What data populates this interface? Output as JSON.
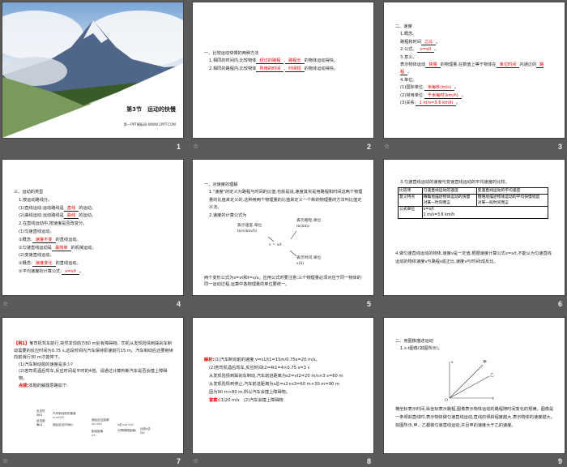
{
  "slides": {
    "1": {
      "number": "1",
      "title": "第3节　运动的快慢",
      "subtitle": "第一PPT模板网-WWW.1PPT.COM"
    },
    "2": {
      "number": "2",
      "lines": [
        [
          {
            "t": "一、比较运动快慢的两种方法"
          }
        ],
        [
          {
            "t": "1.相同的时间内,比较物体"
          },
          {
            "t": "经过的路程",
            "b": true
          },
          {
            "t": ","
          },
          {
            "t": "路程长",
            "b": true
          },
          {
            "t": "的物体运动得快。"
          }
        ],
        [
          {
            "t": "2.相同的路程内,比较物体"
          },
          {
            "t": "所用的时间",
            "b": true
          },
          {
            "t": ","
          },
          {
            "t": "时间短",
            "b": true
          },
          {
            "t": "的物体运动得快。"
          }
        ]
      ]
    },
    "3": {
      "number": "3",
      "lines": [
        [
          {
            "t": "二、速度"
          }
        ],
        [
          {
            "t": "1.概念。"
          }
        ],
        [
          {
            "t": "路程和时间"
          },
          {
            "t": "之比",
            "b": true
          },
          {
            "t": "。"
          }
        ],
        [
          {
            "t": "2.公式。"
          },
          {
            "t": "v=s/t",
            "b": true
          },
          {
            "t": "。"
          }
        ],
        [
          {
            "t": "3.意义。"
          }
        ],
        [
          {
            "t": "表示物体运动"
          },
          {
            "t": "快慢",
            "b": true
          },
          {
            "t": "的物理量,在数值上等于物体在"
          },
          {
            "t": "单位时间",
            "b": true
          },
          {
            "t": "内通过的"
          },
          {
            "t": "路程",
            "b": true
          },
          {
            "t": "。"
          }
        ],
        [
          {
            "t": "4.单位。"
          }
        ],
        [
          {
            "t": "(1)国际单位:"
          },
          {
            "t": "米每秒(m/s)",
            "b": true
          },
          {
            "t": "。"
          }
        ],
        [
          {
            "t": "(2)常用单位:"
          },
          {
            "t": "千米每时(km/h)",
            "b": true
          },
          {
            "t": "。"
          }
        ],
        [
          {
            "t": "(3)关系:"
          },
          {
            "t": "1 m/s=3.6 km/h",
            "b": true
          },
          {
            "t": "。"
          }
        ]
      ]
    },
    "4": {
      "number": "4",
      "lines": [
        [
          {
            "t": "三、运动的类型"
          }
        ],
        [
          {
            "t": "1.按运动路线分。"
          }
        ],
        [
          {
            "t": "(1)直线运动:运动路线是"
          },
          {
            "t": "直线",
            "b": true
          },
          {
            "t": "的运动。"
          }
        ],
        [
          {
            "t": "(2)曲线运动:运动路线是"
          },
          {
            "t": "曲线",
            "b": true
          },
          {
            "t": "的运动。"
          }
        ],
        [
          {
            "t": "2.在直线运动中,按速度是否改变分。"
          }
        ],
        [
          {
            "t": "(1)匀速直线运动。"
          }
        ],
        [
          {
            "t": "①概念:"
          },
          {
            "t": "速度不变",
            "b": true
          },
          {
            "t": "的直线运动。"
          }
        ],
        [
          {
            "t": "②匀速直线运动是"
          },
          {
            "t": "最简单",
            "b": true
          },
          {
            "t": "的机械运动。"
          }
        ],
        [
          {
            "t": "(2)变速直线运动。"
          }
        ],
        [
          {
            "t": "①概念:"
          },
          {
            "t": "速度变化",
            "b": true
          },
          {
            "t": "的直线运动。"
          }
        ],
        [
          {
            "t": "②平均速度的计算公式:"
          },
          {
            "t": "v=s/t",
            "b": true
          },
          {
            "t": "。"
          }
        ]
      ]
    },
    "5": {
      "number": "5",
      "lines": [
        [
          {
            "t": "一、对速度的理解"
          }
        ],
        [
          {
            "t": "1.\"速度\"的定义为路程与时间的比值,也就是说,速度其实是用路程和时间这两个物理量的比值来定义的,这种用两个物理量的比值来定义一个新的物理量的方法叫比值定义法。"
          }
        ],
        [
          {
            "t": "2.速度的计算公式为"
          }
        ]
      ],
      "diagram": {
        "v_label": "表示速度,单位 m/s(km/h)",
        "s_label": "表示路程,单位 m(km)",
        "t_label": "表示时间,单位 s(h)",
        "formula": "v = s/t"
      },
      "footer": "两个变形公式为s=vt和t=s/v。应用公式时要注意:三个物理量必须对应于同一物体的同一运动过程,运算中各物理量的单位要统一。"
    },
    "6": {
      "number": "6",
      "heading": "3.匀速直线运动的速度与变速直线运动的平均速度的比较。",
      "table": {
        "headers": [
          "比较项",
          "匀速直线运动的速度",
          "变速直线运动的平均速度"
        ],
        "row1_label": "意义特点",
        "row1_a": "精确地描述物体运动的快慢",
        "row1_a2": "对某一时刻而言",
        "row1_b": "粗略地描述物体运动的平均快慢程度",
        "row1_b2": "对某一段时间而言",
        "row2_label": "公式单位",
        "row2_formula": "v=s/t",
        "row2_unit": "1 m/s=3.6 km/h"
      },
      "note": "4.做匀速直线运动的物体,速度v是一定值,根据速度计算公式v=s/t,不能认为匀速直线运动的物体速度v与路程s成正比,速度v与时间t成反比。"
    },
    "7": {
      "number": "7",
      "example_tag": "【例1】",
      "example": "某司机驾车前行,突然发现前方80 m处有障碍物。司机从发现险情到踩刹车制动需要的反应时间为0.75 s,这段时间内汽车保持原速前行15 m。汽车制动后还要继续向前滑行30 m才能停下。",
      "q1": "(1)汽车制动前的速度是多少?",
      "q2": "(2)若司机酒后驾车,反应时间是平时的4倍。请通过计算判断汽车是否会撞上障碍物。",
      "hint_tag": "点拨:",
      "hint": "本题的解题思路如下:",
      "flow": {
        "a": "反应时间t1",
        "b": "反应距离s1",
        "c": "汽车制动前的速度v=s1/t1",
        "d": "酒后反应时间t2",
        "e": "酒后反应距离s2=vt2",
        "f": "制动距离s3",
        "g": "s总=s2+s3",
        "h": "与障碍物距离s",
        "i": "比较s总与s"
      }
    },
    "8": {
      "number": "8",
      "lines": [
        [
          {
            "t": "解析:",
            "r": true
          },
          {
            "t": "(1)汽车制动前的速度 v=s1/t1=15m/0.75s=20 m/s。"
          }
        ],
        [
          {
            "t": "(2)若司机酒后驾车,反应时间t2=4t1=4×0.75 s=3 s"
          }
        ],
        [
          {
            "t": "从发现险情到踩刹车制动,汽车前进距离为s2=vt2=20 m/s×3 s=60 m"
          }
        ],
        [
          {
            "t": "从发现险情到停止,汽车前进距离为s总=s2+s3=60 m+30 m=90 m"
          }
        ],
        [
          {
            "t": "因为90 m>80 m,所以汽车会撞上障碍物。"
          }
        ],
        [
          {
            "t": "答案:",
            "r": true
          },
          {
            "t": "(1)20 m/s　(2)汽车会撞上障碍物"
          }
        ]
      ]
    },
    "9": {
      "number": "9",
      "lines": [
        [
          {
            "t": "二、用图像描述运动"
          }
        ],
        [
          {
            "t": "1.s-t图像(如图所示)。"
          }
        ]
      ],
      "graph": {
        "y_axis": "s",
        "x_axis": "t",
        "origin": "O",
        "line_a": "甲",
        "line_b": "乙"
      },
      "footer": "横坐标表示时间,纵坐标表示路程,图像表示物体运动的路程随时间变化的规律。图像是一条倾斜直线时,表示物体做匀速直线运动,直线的倾斜程度越大,表示物体的速度越大。如图所示,甲、乙都做匀速直线运动,并且甲的速度大于乙的速度。"
    }
  },
  "icons": {
    "animation": "star-icon"
  }
}
